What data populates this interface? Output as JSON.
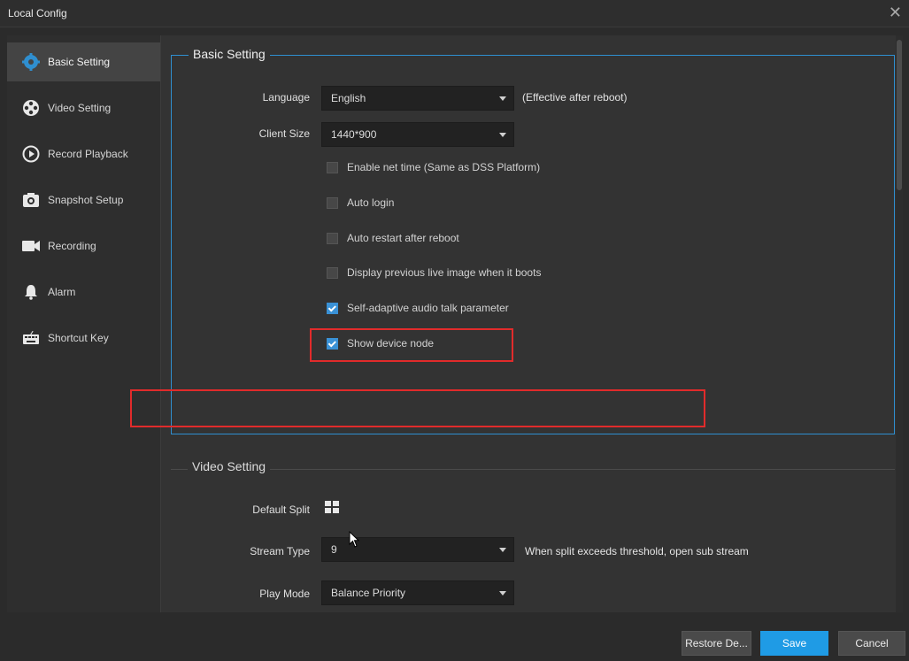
{
  "window": {
    "title": "Local Config",
    "close_glyph": "✕"
  },
  "sidebar": {
    "items": [
      {
        "label": "Basic Setting",
        "icon": "gear-icon",
        "active": true
      },
      {
        "label": "Video Setting",
        "icon": "film-reel-icon"
      },
      {
        "label": "Record Playback",
        "icon": "playback-icon"
      },
      {
        "label": "Snapshot Setup",
        "icon": "camera-icon"
      },
      {
        "label": "Recording",
        "icon": "video-camera-icon"
      },
      {
        "label": "Alarm",
        "icon": "bell-icon"
      },
      {
        "label": "Shortcut Key",
        "icon": "keyboard-icon"
      }
    ]
  },
  "basic": {
    "title": "Basic Setting",
    "language_label": "Language",
    "language_value": "English",
    "language_hint": "(Effective after reboot)",
    "client_size_label": "Client Size",
    "client_size_value": "1440*900",
    "options": [
      {
        "label": "Enable net time (Same as DSS Platform)",
        "checked": false
      },
      {
        "label": "Auto login",
        "checked": false
      },
      {
        "label": "Auto restart after reboot",
        "checked": false
      },
      {
        "label": "Display previous live image when it boots",
        "checked": false
      },
      {
        "label": "Self-adaptive audio talk parameter",
        "checked": true
      },
      {
        "label": "Show device node",
        "checked": true
      }
    ]
  },
  "video": {
    "title": "Video Setting",
    "default_split_label": "Default Split",
    "stream_type_label": "Stream Type",
    "stream_type_value": "9",
    "stream_type_hint": "When split exceeds threshold, open sub stream",
    "play_mode_label": "Play Mode",
    "play_mode_value": "Balance Priority"
  },
  "footer": {
    "restore_label": "Restore De...",
    "save_label": "Save",
    "cancel_label": "Cancel"
  },
  "colors": {
    "accent": "#1f9be5",
    "highlight_border": "#e12b2b",
    "group_border": "#2f8fd0"
  }
}
